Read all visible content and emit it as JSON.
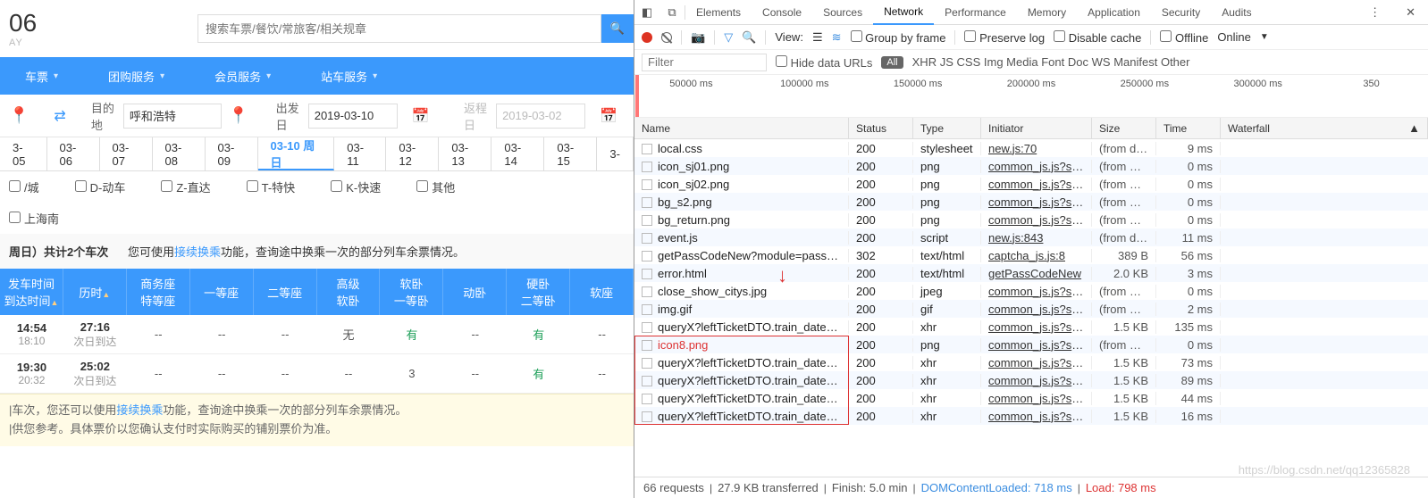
{
  "logo": {
    "big": "06",
    "small": "AY"
  },
  "search": {
    "placeholder": "搜索车票/餐饮/常旅客/相关规章"
  },
  "nav": [
    "车票",
    "团购服务",
    "会员服务",
    "站车服务"
  ],
  "form": {
    "dest_label": "目的地",
    "dest": "呼和浩特",
    "dep_label": "出发日",
    "dep": "2019-03-10",
    "ret_label": "返程日",
    "ret": "2019-03-02"
  },
  "dates": [
    {
      "label": "3-05"
    },
    {
      "label": "03-06"
    },
    {
      "label": "03-07"
    },
    {
      "label": "03-08"
    },
    {
      "label": "03-09"
    },
    {
      "label": "03-10 周日",
      "selected": true
    },
    {
      "label": "03-11"
    },
    {
      "label": "03-12"
    },
    {
      "label": "03-13"
    },
    {
      "label": "03-14"
    },
    {
      "label": "03-15"
    },
    {
      "label": "3-"
    }
  ],
  "filters1": [
    "/城",
    "D-动车",
    "Z-直达",
    "T-特快",
    "K-快速",
    "其他"
  ],
  "filters2": [
    "上海南"
  ],
  "summary": {
    "prefix": "周日）共计",
    "count": "2",
    "count_suffix": "个车次",
    "tip": "您可使用",
    "link": "接续换乘",
    "tail": "功能，查询途中换乘一次的部分列车余票情况。"
  },
  "columns": [
    "发车时间\n到达时间",
    "历时",
    "商务座\n特等座",
    "一等座",
    "二等座",
    "高级\n软卧",
    "软卧\n一等卧",
    "动卧",
    "硬卧\n二等卧",
    "软座"
  ],
  "trains": [
    {
      "dep": "14:54",
      "arr": "18:10",
      "dur": "27:16",
      "durNote": "次日到达",
      "cells": [
        "--",
        "--",
        "--",
        "无",
        "有",
        "--",
        "有",
        "--"
      ]
    },
    {
      "dep": "19:30",
      "arr": "20:32",
      "dur": "25:02",
      "durNote": "次日到达",
      "cells": [
        "--",
        "--",
        "--",
        "--",
        "3",
        "--",
        "有",
        "--"
      ]
    }
  ],
  "footer": {
    "l1_a": "|车次，您还可以使用",
    "l1_link": "接续换乘",
    "l1_b": "功能，查询途中换乘一次的部分列车余票情况。",
    "l2": "|供您参考。具体票价以您确认支付时实际购买的铺别票价为准。"
  },
  "devtools": {
    "panels": [
      "Elements",
      "Console",
      "Sources",
      "Network",
      "Performance",
      "Memory",
      "Application",
      "Security",
      "Audits"
    ],
    "active_panel": "Network",
    "toolbar": {
      "view": "View:",
      "group": "Group by frame",
      "preserve": "Preserve log",
      "disable": "Disable cache",
      "offline": "Offline",
      "online": "Online"
    },
    "filter": {
      "placeholder": "Filter",
      "hide": "Hide data URLs",
      "all": "All",
      "cats": [
        "XHR",
        "JS",
        "CSS",
        "Img",
        "Media",
        "Font",
        "Doc",
        "WS",
        "Manifest",
        "Other"
      ]
    },
    "timeline": [
      "50000 ms",
      "100000 ms",
      "150000 ms",
      "200000 ms",
      "250000 ms",
      "300000 ms",
      "350"
    ],
    "headers": [
      "Name",
      "Status",
      "Type",
      "Initiator",
      "Size",
      "Time",
      "Waterfall"
    ],
    "rows": [
      {
        "name": "local.css",
        "status": "200",
        "type": "stylesheet",
        "init": "new.js:70",
        "size": "(from dis...",
        "time": "9 ms",
        "wf": 5
      },
      {
        "name": "icon_sj01.png",
        "status": "200",
        "type": "png",
        "init": "common_js.js?scri...",
        "size": "(from me...",
        "time": "0 ms",
        "wf": 5
      },
      {
        "name": "icon_sj02.png",
        "status": "200",
        "type": "png",
        "init": "common_js.js?scri...",
        "size": "(from me...",
        "time": "0 ms",
        "wf": 5
      },
      {
        "name": "bg_s2.png",
        "status": "200",
        "type": "png",
        "init": "common_js.js?scri...",
        "size": "(from me...",
        "time": "0 ms",
        "wf": 5
      },
      {
        "name": "bg_return.png",
        "status": "200",
        "type": "png",
        "init": "common_js.js?scri...",
        "size": "(from me...",
        "time": "0 ms",
        "wf": 5
      },
      {
        "name": "event.js",
        "status": "200",
        "type": "script",
        "init": "new.js:843",
        "size": "(from dis...",
        "time": "11 ms",
        "wf": 6
      },
      {
        "name": "getPassCodeNew?module=passenge...",
        "status": "302",
        "type": "text/html",
        "init": "captcha_js.js:8",
        "size": "389 B",
        "time": "56 ms",
        "wf": 12
      },
      {
        "name": "error.html",
        "status": "200",
        "type": "text/html",
        "init": "getPassCodeNew",
        "size": "2.0 KB",
        "time": "3 ms",
        "wf": 6
      },
      {
        "name": "close_show_citys.jpg",
        "status": "200",
        "type": "jpeg",
        "init": "common_js.js?scri...",
        "size": "(from me...",
        "time": "0 ms",
        "wf": 5
      },
      {
        "name": "img.gif",
        "status": "200",
        "type": "gif",
        "init": "common_js.js?scri...",
        "size": "(from me...",
        "time": "2 ms",
        "wf": 6
      },
      {
        "name": "queryX?leftTicketDTO.train_date=201...",
        "status": "200",
        "type": "xhr",
        "init": "common_js.js?scri...",
        "size": "1.5 KB",
        "time": "135 ms",
        "wf": 45
      },
      {
        "name": "icon8.png",
        "status": "200",
        "type": "png",
        "init": "common_js.js?scri...",
        "size": "(from me...",
        "time": "0 ms",
        "wf": 38,
        "red": true
      },
      {
        "name": "queryX?leftTicketDTO.train_date=201...",
        "status": "200",
        "type": "xhr",
        "init": "common_js.js?scri...",
        "size": "1.5 KB",
        "time": "73 ms",
        "wf": 58
      },
      {
        "name": "queryX?leftTicketDTO.train_date=201...",
        "status": "200",
        "type": "xhr",
        "init": "common_js.js?scri...",
        "size": "1.5 KB",
        "time": "89 ms",
        "wf": 62
      },
      {
        "name": "queryX?leftTicketDTO.train_date=201...",
        "status": "200",
        "type": "xhr",
        "init": "common_js.js?scri...",
        "size": "1.5 KB",
        "time": "44 ms",
        "wf": 66
      },
      {
        "name": "queryX?leftTicketDTO.train_date=201...",
        "status": "200",
        "type": "xhr",
        "init": "common_js.js?scri...",
        "size": "1.5 KB",
        "time": "16 ms",
        "wf": 70
      }
    ],
    "status": {
      "req": "66 requests",
      "kb": "27.9 KB transferred",
      "finish": "Finish: 5.0 min",
      "dom": "DOMContentLoaded: 718 ms",
      "load": "Load: 798 ms"
    }
  },
  "watermark": "https://blog.csdn.net/qq12365828"
}
